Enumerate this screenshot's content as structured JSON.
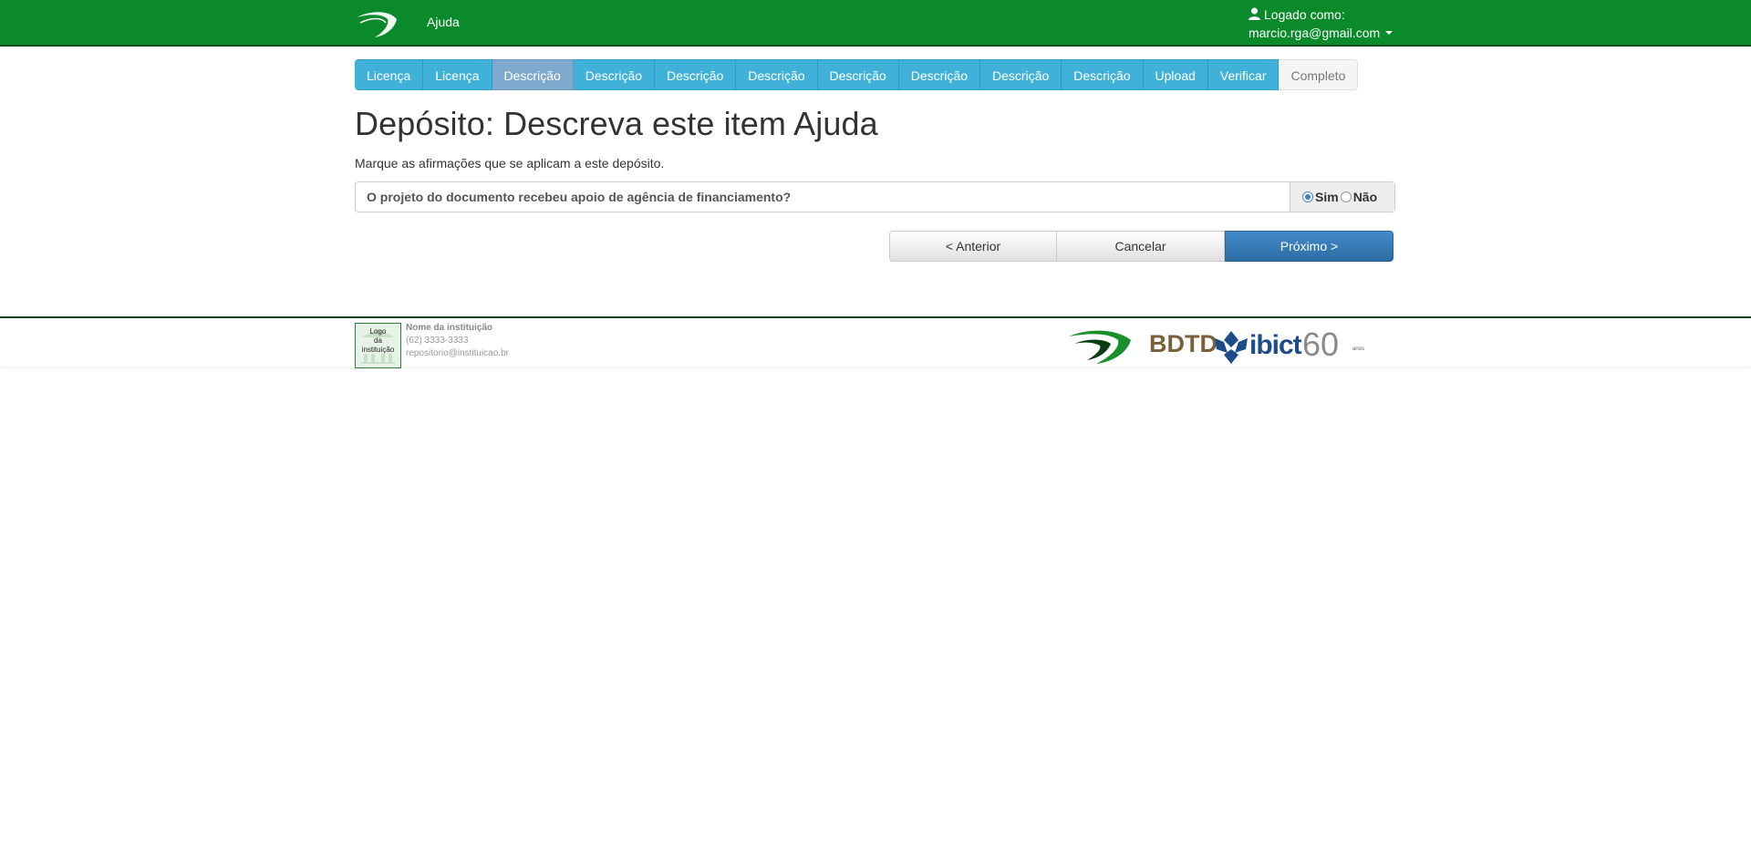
{
  "navbar": {
    "help_label": "Ajuda",
    "user_prefix": "Logado como:",
    "user_email": "marcio.rga@gmail.com"
  },
  "progress": {
    "steps": [
      {
        "label": "Licença",
        "state": "done"
      },
      {
        "label": "Licença",
        "state": "done"
      },
      {
        "label": "Descrição",
        "state": "current"
      },
      {
        "label": "Descrição",
        "state": "todo"
      },
      {
        "label": "Descrição",
        "state": "todo"
      },
      {
        "label": "Descrição",
        "state": "todo"
      },
      {
        "label": "Descrição",
        "state": "todo"
      },
      {
        "label": "Descrição",
        "state": "todo"
      },
      {
        "label": "Descrição",
        "state": "todo"
      },
      {
        "label": "Descrição",
        "state": "todo"
      },
      {
        "label": "Upload",
        "state": "todo"
      },
      {
        "label": "Verificar",
        "state": "todo"
      },
      {
        "label": "Completo",
        "state": "disabled"
      }
    ]
  },
  "main": {
    "title": "Depósito: Descreva este item Ajuda",
    "instructions": "Marque as afirmações que se aplicam a este depósito.",
    "question": "O projeto do documento recebeu apoio de agência de financiamento?",
    "answer_yes": "Sim",
    "answer_no": "Não",
    "selected": "Sim"
  },
  "buttons": {
    "previous": "< Anterior",
    "cancel": "Cancelar",
    "next": "Próximo >"
  },
  "footer": {
    "logo_text_line1": "Logo",
    "logo_text_line2": "da",
    "logo_text_line3": "instituição",
    "institution_name": "Nome da instituição",
    "phone": "(62) 3333-3333",
    "email": "repositorio@instituicao.br",
    "partner_bdtd": "BDTD",
    "partner_ibict": "ibict",
    "partner_sixty": "60",
    "partner_anos": "anos"
  },
  "colors": {
    "navbar": "#0a8a2b",
    "step": "#40b1d9",
    "step_current": "#7fa9cd",
    "primary_button": "#337ab7"
  }
}
